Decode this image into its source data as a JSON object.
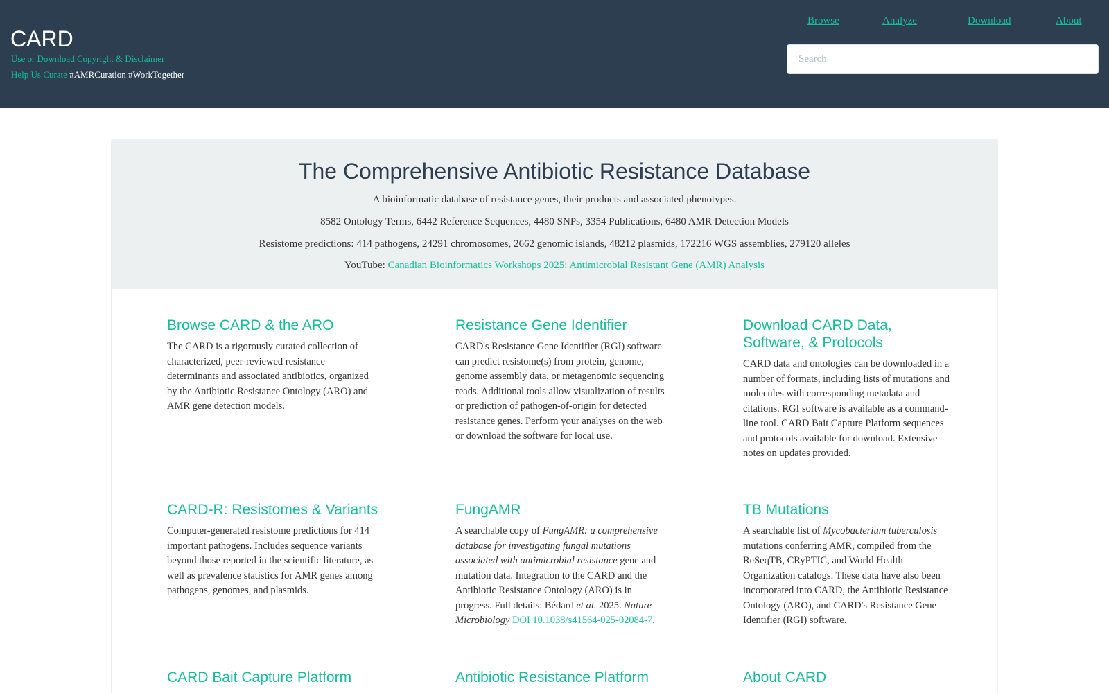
{
  "header": {
    "brand": "CARD",
    "copyright_line": "Use or Download Copyright & Disclaimer",
    "help_link": "Help Us Curate",
    "hashtags": " #AMRCuration #WorkTogether",
    "nav": [
      "Browse",
      "Analyze",
      "Download",
      "About"
    ],
    "search_placeholder": "Search"
  },
  "jumbotron": {
    "title": "The Comprehensive Antibiotic Resistance Database",
    "tagline": "A bioinformatic database of resistance genes, their products and associated phenotypes.",
    "stats": "8582 Ontology Terms, 6442 Reference Sequences, 4480 SNPs, 3354 Publications, 6480 AMR Detection Models",
    "resistome": "Resistome predictions: 414 pathogens, 24291 chromosomes, 2662 genomic islands, 48212 plasmids, 172216 WGS assemblies, 279120 alleles",
    "youtube_label": "YouTube: ",
    "youtube_link": "Canadian Bioinformatics Workshops 2025: Antimicrobial Resistant Gene (AMR) Analysis"
  },
  "cards": {
    "browse": {
      "title": "Browse CARD & the ARO",
      "text": "The CARD is a rigorously curated collection of characterized, peer-reviewed resistance determinants and associated antibiotics, organized by the Antibiotic Resistance Ontology (ARO) and AMR gene detection models."
    },
    "rgi": {
      "title": "Resistance Gene Identifier",
      "text": "CARD's Resistance Gene Identifier (RGI) software can predict resistome(s) from protein, genome, genome assembly data, or metagenomic sequencing reads. Additional tools allow visualization of results or prediction of pathogen-of-origin for detected resistance genes. Perform your analyses on the web or download the software for local use."
    },
    "download": {
      "title": "Download CARD Data, Software, & Protocols",
      "text": "CARD data and ontologies can be downloaded in a number of formats, including lists of mutations and molecules with corresponding metadata and citations. RGI software is available as a command-line tool. CARD Bait Capture Platform sequences and protocols available for download. Extensive notes on updates provided."
    },
    "cardr": {
      "title": "CARD-R: Resistomes & Variants",
      "text": "Computer-generated resistome predictions for 414 important pathogens. Includes sequence variants beyond those reported in the scientific literature, as well as prevalence statistics for AMR genes among pathogens, genomes, and plasmids."
    },
    "fungamr": {
      "title": "FungAMR",
      "t1": "A searchable copy of ",
      "t2": "FungAMR: a comprehensive database for investigating fungal mutations associated with antimicrobial resistance",
      "t3": " gene and mutation data. Integration to the CARD and the Antibiotic Resistance Ontology (ARO) is in progress. Full details: Bédard ",
      "t4": "et al.",
      "t5": " 2025. ",
      "t6": "Nature Microbiology",
      "t7": " ",
      "doi": "DOI 10.1038/s41564-025-02084-7",
      "t8": "."
    },
    "tb": {
      "title": "TB Mutations",
      "t1": "A searchable list of ",
      "t2": "Mycobacterium tuberculosis",
      "t3": " mutations conferring AMR, compiled from the ReSeqTB, CRyPTIC, and World Health Organization catalogs. These data have also been incorporated into CARD, the Antibiotic Resistance Ontology (ARO), and CARD's Resistance Gene Identifier (RGI) software."
    },
    "bait": {
      "title": "CARD Bait Capture Platform"
    },
    "platform": {
      "title": "Antibiotic Resistance Platform"
    },
    "about": {
      "title": "About CARD"
    }
  }
}
